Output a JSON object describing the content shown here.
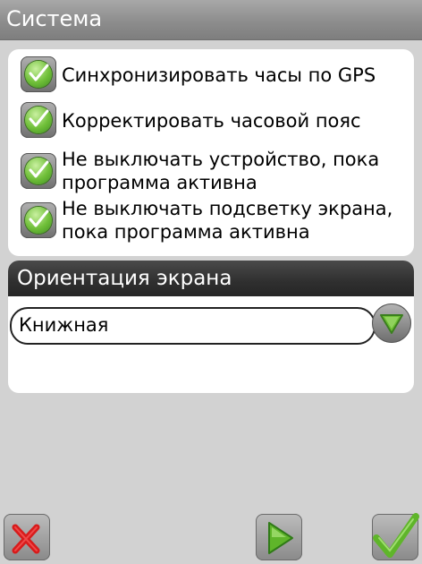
{
  "title": "Система",
  "options": [
    {
      "label": "Синхронизировать часы по GPS",
      "checked": true
    },
    {
      "label": "Корректировать часовой пояс",
      "checked": true
    },
    {
      "label": "Не выключать устройство, пока программа активна",
      "checked": true
    },
    {
      "label": "Не выключать подсветку экрана, пока программа активна",
      "checked": true
    }
  ],
  "orientation": {
    "header": "Ориентация экрана",
    "selected": "Книжная"
  },
  "icons": {
    "checkbox": "check-icon",
    "dropdown": "chevron-down-icon",
    "cancel": "close-icon",
    "next": "play-icon",
    "confirm": "check-icon"
  },
  "colors": {
    "accent_green": "#5fb52a",
    "cancel_red": "#d81b1b"
  }
}
